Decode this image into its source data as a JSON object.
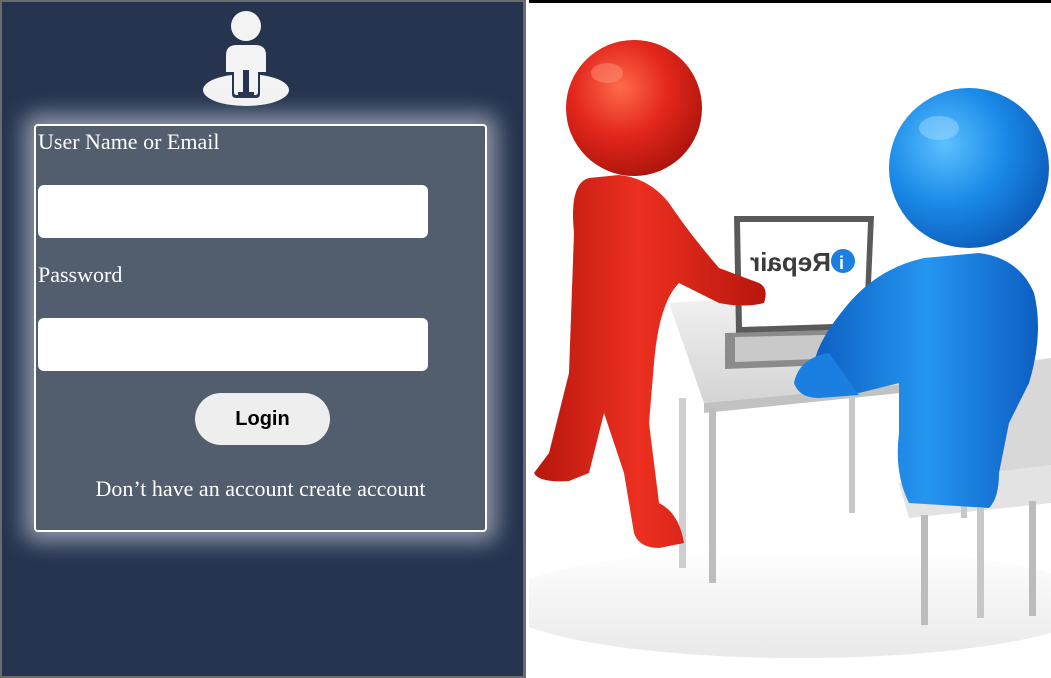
{
  "icons": {
    "user": "user-icon"
  },
  "form": {
    "username_label": "User Name or Email",
    "username_value": "",
    "username_placeholder": "",
    "password_label": "Password",
    "password_value": "",
    "password_placeholder": "",
    "login_label": "Login",
    "no_account_text": "Don’t have an account",
    "create_account_link": "create account"
  },
  "illustration": {
    "laptop_brand_text": "Repair",
    "laptop_brand_icon": "i",
    "description": "repair-service-illustration"
  },
  "colors": {
    "panel_background": "#26344f",
    "form_background": "#525d6e",
    "red_figure": "#e3271c",
    "blue_figure": "#1a7fe0"
  }
}
